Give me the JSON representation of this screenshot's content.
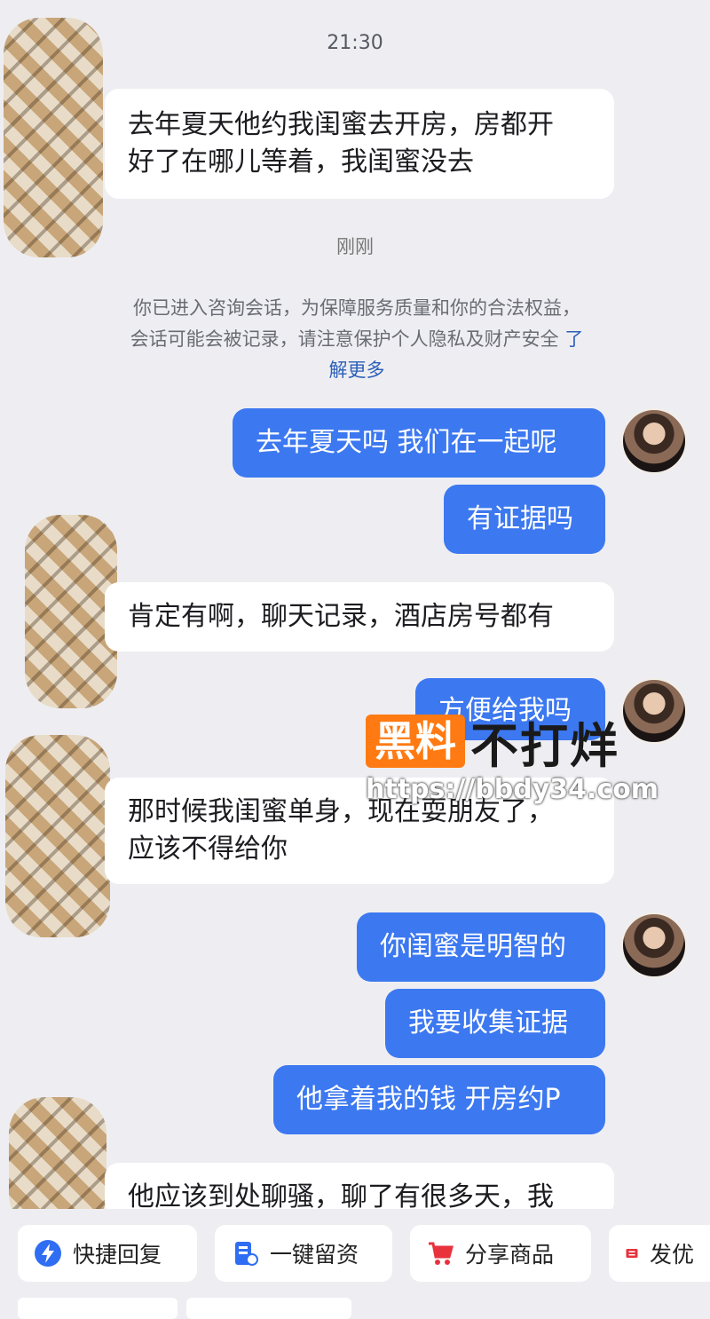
{
  "chat": {
    "time_top": "21:30",
    "time_mid": "刚刚",
    "notice_line1": "你已进入咨询会话，为保障服务质量和你的合法权益，",
    "notice_line2": "会话可能会被记录，请注意保护个人隐私及财产安全",
    "notice_link_a": "了",
    "notice_link_b": "解更多",
    "messages": [
      {
        "side": "in",
        "lines": [
          "去年夏天他约我闺蜜去开房，房都开",
          "好了在哪儿等着，我闺蜜没去"
        ]
      },
      {
        "side": "out",
        "lines": [
          "去年夏天吗 我们在一起呢"
        ]
      },
      {
        "side": "out",
        "lines": [
          "有证据吗"
        ]
      },
      {
        "side": "in",
        "lines": [
          "肯定有啊，聊天记录，酒店房号都有"
        ]
      },
      {
        "side": "out",
        "lines": [
          "方便给我吗"
        ]
      },
      {
        "side": "in",
        "lines": [
          "那时候我闺蜜单身，现在耍朋友了，",
          "应该不得给你"
        ]
      },
      {
        "side": "out",
        "lines": [
          "你闺蜜是明智的"
        ]
      },
      {
        "side": "out",
        "lines": [
          "我要收集证据"
        ]
      },
      {
        "side": "out",
        "lines": [
          "他拿着我的钱 开房约P"
        ]
      },
      {
        "side": "in",
        "lines": [
          "他应该到处聊骚，聊了有很多天，我"
        ]
      }
    ]
  },
  "watermark": {
    "brand_box": "黑料",
    "brand_text": "不打烊",
    "url": "https://bbdy34.com"
  },
  "quick_actions": [
    {
      "label": "快捷回复",
      "icon": "lightning-icon",
      "color": "#2f6ef2"
    },
    {
      "label": "一键留资",
      "icon": "form-icon",
      "color": "#2f6ef2"
    },
    {
      "label": "分享商品",
      "icon": "cart-icon",
      "color": "#e8323c"
    },
    {
      "label": "发优",
      "icon": "coupon-icon",
      "color": "#e8323c"
    }
  ]
}
